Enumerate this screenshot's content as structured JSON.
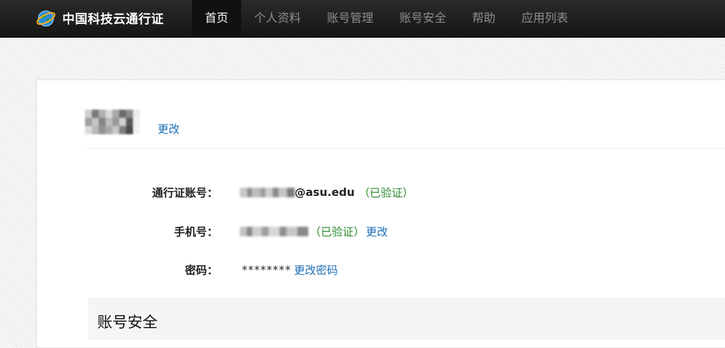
{
  "header": {
    "brand": "中国科技云通行证",
    "logo_icon": "globe-logo-icon",
    "nav": [
      {
        "label": "首页",
        "active": true
      },
      {
        "label": "个人资料",
        "active": false
      },
      {
        "label": "账号管理",
        "active": false
      },
      {
        "label": "账号安全",
        "active": false
      },
      {
        "label": "帮助",
        "active": false
      },
      {
        "label": "应用列表",
        "active": false
      }
    ]
  },
  "profile": {
    "avatar_change": "更改"
  },
  "account": {
    "passport_label": "通行证账号：",
    "passport_value_suffix": "@asu.edu",
    "passport_status": "（已验证）",
    "phone_label": "手机号：",
    "phone_status": "（已验证）",
    "phone_change": "更改",
    "password_label": "密码：",
    "password_value": "********",
    "password_change": "更改密码"
  },
  "security": {
    "title": "账号安全"
  },
  "colors": {
    "link": "#1f6fb4",
    "verified": "#2f8a2f",
    "topbar": "#1b1b1b"
  }
}
